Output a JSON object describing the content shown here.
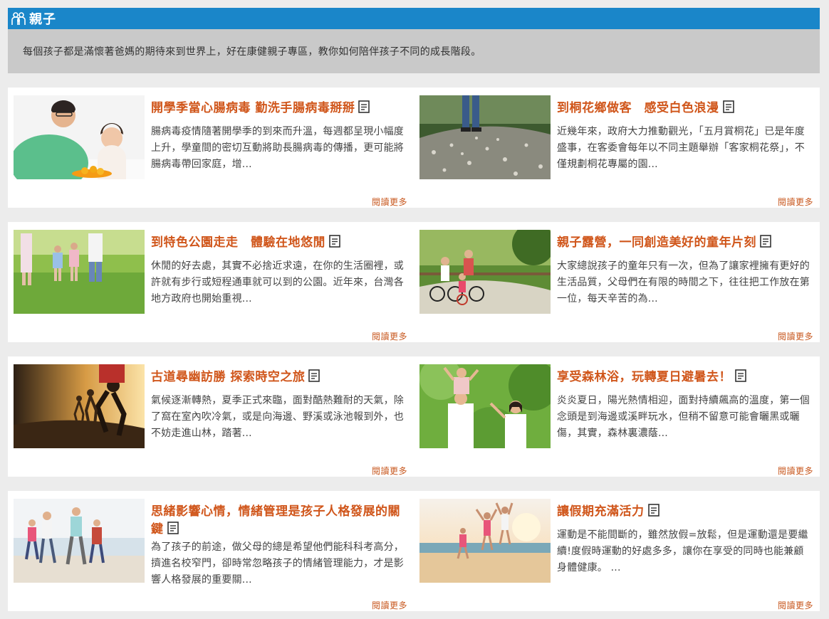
{
  "section": {
    "title": "親子",
    "icon": "family-icon",
    "intro": "每個孩子都是滿懷著爸媽的期待來到世界上，好在康健親子專區，教你如何陪伴孩子不同的成長階段。"
  },
  "colors": {
    "header_bg": "#1a86c9",
    "intro_bg": "#c9c9c9",
    "title": "#d0561b",
    "link": "#c8581f"
  },
  "read_more_label": "閱讀更多",
  "articles": [
    {
      "title": "開學季當心腸病毒 勤洗手腸病毒掰掰",
      "excerpt": "腸病毒疫情隨著開學季的到來而升溫，每週都呈現小幅度上升，學童間的密切互動將助長腸病毒的傳播，更可能將腸病毒帶回家庭，增...",
      "image": "father-daughter-eating-orange",
      "icon": "document-icon"
    },
    {
      "title": "到桐花鄉做客　感受白色浪漫",
      "excerpt": "近幾年來，政府大力推動觀光，「五月賞桐花」已是年度盛事，在客委會每年以不同主題舉辦「客家桐花祭」，不僅規劃桐花專屬的園...",
      "image": "path-covered-tung-flowers",
      "icon": "document-icon"
    },
    {
      "title": "到特色公園走走　體驗在地悠閒",
      "excerpt": "休閒的好去處，其實不必捨近求遠，在你的生活圈裡，或許就有步行或短程通車就可以到的公園。近年來，台灣各地方政府也開始重視...",
      "image": "family-walking-in-park",
      "icon": "document-icon"
    },
    {
      "title": "親子露營，一同創造美好的童年片刻",
      "excerpt": "大家總說孩子的童年只有一次，但為了讓家裡擁有更好的生活品質，父母們在有限的時間之下，往往把工作放在第一位，每天辛苦的為...",
      "image": "family-cycling",
      "icon": "document-icon"
    },
    {
      "title": "古道尋幽訪勝 探索時空之旅",
      "excerpt": "氣候逐漸轉熱，夏季正式來臨，面對酷熱難耐的天氣，除了窩在室內吹冷氣，或是向海邊、野溪或泳池報到外，也不妨走進山林，踏著...",
      "image": "hikers-at-sunset",
      "icon": "document-icon"
    },
    {
      "title": "享受森林浴，玩轉夏日避暑去！",
      "excerpt": "炎炎夏日，陽光熱情相迎，面對持續飆高的溫度，第一個念頭是到海邊或溪畔玩水，但稍不留意可能會曬黑或曬傷，其實，森林裏濃蔭...",
      "image": "family-in-forest",
      "icon": "document-icon"
    },
    {
      "title": "思緒影響心情，情緒管理是孩子人格發展的關鍵",
      "excerpt": "為了孩子的前途，做父母的總是希望他們能科科考高分，擠進名校窄門，卻時常忽略孩子的情緒管理能力，才是影響人格發展的重要關...",
      "image": "family-running-on-beach",
      "icon": "document-icon"
    },
    {
      "title": "讓假期充滿活力",
      "excerpt": "運動是不能間斷的，雖然放假=放鬆，但是運動還是要繼續!度假時運動的好處多多，讓你在享受的同時也能兼顧身體健康。 ...",
      "image": "friends-jumping-on-beach",
      "icon": "document-icon"
    }
  ]
}
